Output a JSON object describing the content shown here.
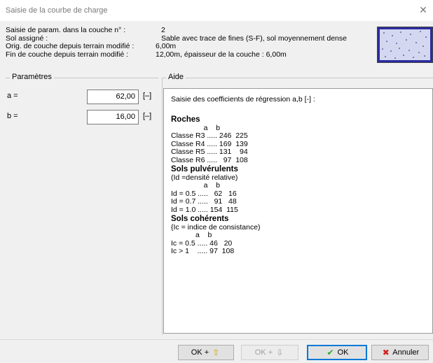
{
  "window": {
    "title": "Saisie de la courbe de charge"
  },
  "info": [
    {
      "label": "Saisie de param. dans la couche n° :",
      "value": "2"
    },
    {
      "label": "Sol assigné :",
      "value": "Sable avec trace de fines (S-F), sol moyennement dense"
    },
    {
      "label": "Orig. de couche depuis terrain modifié :",
      "value": "6,00m"
    },
    {
      "label": "Fin de couche depuis terrain modifié :",
      "value": "12,00m, épaisseur de la couche : 6,00m"
    }
  ],
  "params": {
    "legend": "Paramètres",
    "a": {
      "label": "a =",
      "value": "62,00",
      "unit": "[–]"
    },
    "b": {
      "label": "b =",
      "value": "16,00",
      "unit": "[–]"
    }
  },
  "help": {
    "legend": "Aide",
    "intro": "Saisie des coefficients de régression a,b [-] :",
    "roches": {
      "title": "Roches",
      "body": "                a    b\nClasse R3 ..... 246  225\nClasse R4 ..... 169  139\nClasse R5 ..... 131    94\nClasse R6 .....   97  108"
    },
    "pulv": {
      "title": "Sols pulvérulents",
      "body": "(Id =densité relative)\n                a    b\nId = 0.5 .....   62   16\nId = 0.7 .....   91   48\nId = 1.0 ..... 154  115"
    },
    "coh": {
      "title": "Sols cohérents",
      "body": "{Ic = indice de consistance)\n            a    b\nIc = 0.5 ..... 46   20\nIc > 1    ..... 97  108"
    }
  },
  "buttons": {
    "ok_plus": "OK +",
    "ok_minus": "OK +",
    "ok": "OK",
    "cancel": "Annuler"
  },
  "colors": {
    "accent": "#0078d7",
    "check": "#2fa82f",
    "cancel": "#d32020",
    "arrow": "#d6a400"
  }
}
